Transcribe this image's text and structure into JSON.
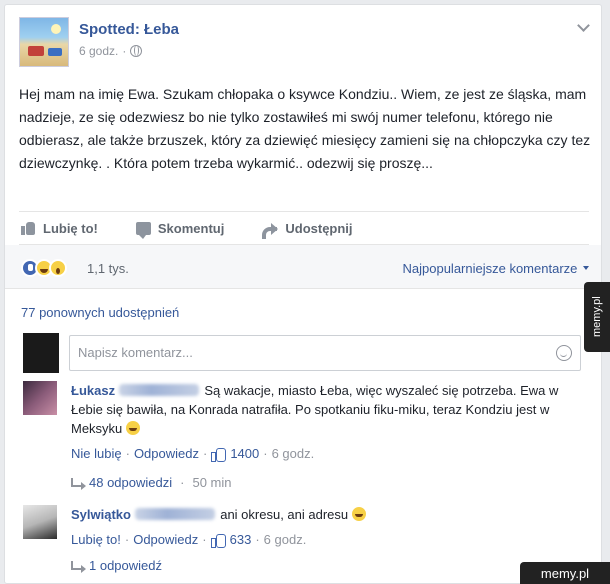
{
  "post": {
    "page_name": "Spotted: Łeba",
    "time": "6 godz.",
    "separator": "·",
    "text": "Hej mam na imię Ewa. Szukam chłopaka o ksywce Kondziu.. Wiem, ze jest ze śląska, mam nadzieje, ze się odezwiesz bo nie tylko zostawiłeś mi swój numer telefonu, którego nie odbierasz, ale także brzuszek, który za dziewięć miesięcy zamieni się na chłopczyka czy tez dziewczynkę. . Która potem trzeba wykarmić.. odezwij się proszę..."
  },
  "actions": {
    "like": "Lubię to!",
    "comment": "Skomentuj",
    "share": "Udostępnij"
  },
  "reactions": {
    "count": "1,1 tys.",
    "sort_label": "Najpopularniejsze komentarze"
  },
  "shares": "77 ponownych udostępnień",
  "composer": {
    "placeholder": "Napisz komentarz..."
  },
  "comments": [
    {
      "name": "Łukasz",
      "text": "Są wakacje, miasto Łeba, więc wyszaleć się potrzeba. Ewa w Łebie się bawiła, na Konrada natrafiła. Po spotkaniu fiku-miku, teraz Kondziu jest w Meksyku",
      "like_label": "Nie lubię",
      "reply_label": "Odpowiedz",
      "likes": "1400",
      "time": "6 godz.",
      "replies": "48 odpowiedzi",
      "replies_time": "50 min"
    },
    {
      "name": "Sylwiątko",
      "text": "ani okresu, ani adresu",
      "like_label": "Lubię to!",
      "reply_label": "Odpowiedz",
      "likes": "633",
      "time": "6 godz.",
      "replies": "1 odpowiedź"
    }
  ],
  "watermark": {
    "side": "memy.pl",
    "footer": "memy.pl"
  }
}
